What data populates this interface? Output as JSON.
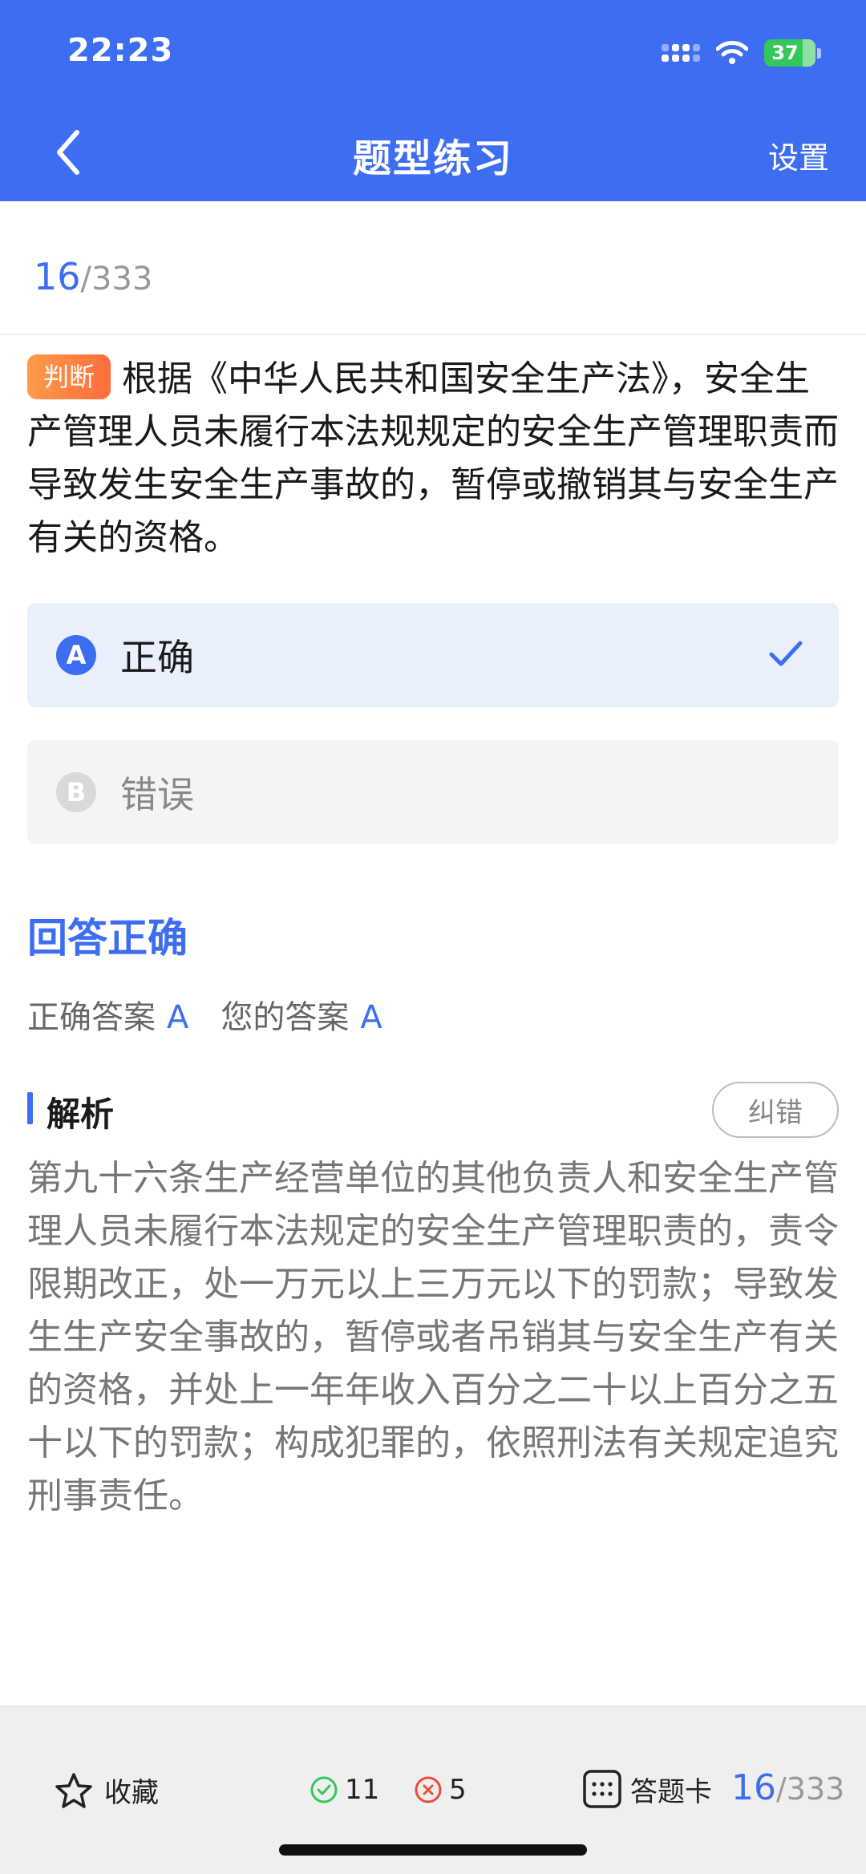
{
  "status_bar": {
    "time": "22:23",
    "battery": "37"
  },
  "nav": {
    "title": "题型练习",
    "settings_label": "设置"
  },
  "progress": {
    "current": "16",
    "total": "/333"
  },
  "question": {
    "type_tag": "判断",
    "text": "根据《中华人民共和国安全生产法》，安全生产管理人员未履行本法规规定的安全生产管理职责而导致发生安全生产事故的，暂停或撤销其与安全生产有关的资格。"
  },
  "options": [
    {
      "letter": "A",
      "text": "正确",
      "selected": true
    },
    {
      "letter": "B",
      "text": "错误",
      "selected": false
    }
  ],
  "result": {
    "title": "回答正确",
    "correct_label": "正确答案",
    "correct_value": "A",
    "your_label": "您的答案",
    "your_value": "A"
  },
  "analysis": {
    "title": "解析",
    "report_label": "纠错",
    "text": "第九十六条生产经营单位的其他负责人和安全生产管理人员未履行本法规定的安全生产管理职责的，责令限期改正，处一万元以上三万元以下的罚款；导致发生生产安全事故的，暂停或者吊销其与安全生产有关的资格，并处上一年年收入百分之二十以上百分之五十以下的罚款；构成犯罪的，依照刑法有关规定追究刑事责任。"
  },
  "bottom_bar": {
    "favorite_label": "收藏",
    "correct_count": "11",
    "wrong_count": "5",
    "answer_card_label": "答题卡",
    "current": "16",
    "total": "/333"
  },
  "colors": {
    "accent": "#3d6ef2",
    "tag": "#ff7a3d",
    "success": "#34c759",
    "error": "#f04a3c"
  },
  "icons": [
    "signal-icon",
    "wifi-icon",
    "battery-icon",
    "back-arrow-icon",
    "check-icon",
    "star-icon",
    "check-circle-icon",
    "x-circle-icon",
    "grid-icon"
  ]
}
